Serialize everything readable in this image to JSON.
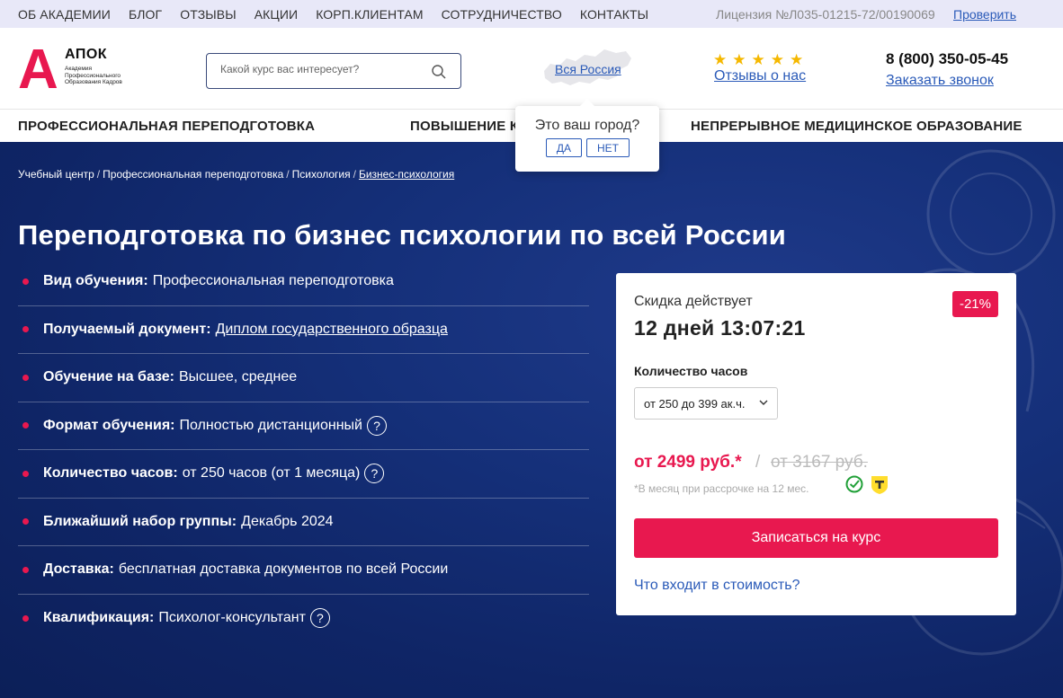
{
  "topbar": {
    "nav": [
      "ОБ АКАДЕМИИ",
      "БЛОГ",
      "ОТЗЫВЫ",
      "АКЦИИ",
      "КОРП.КЛИЕНТАМ",
      "СОТРУДНИЧЕСТВО",
      "КОНТАКТЫ"
    ],
    "license": "Лицензия №Л035-01215-72/00190069",
    "verify": "Проверить"
  },
  "header": {
    "logo_letter": "А",
    "logo_name": "АПОК",
    "logo_sub": "Академия Профессионального Образования Кадров",
    "search_placeholder": "Какой курс вас интересует?",
    "region": "Вся Россия",
    "reviews": "Отзывы о нас",
    "rating_stars": 5,
    "phone": "8 (800) 350-05-45",
    "callback": "Заказать звонок"
  },
  "catnav": {
    "items": [
      "ПРОФЕССИОНАЛЬНАЯ ПЕРЕПОДГОТОВКА",
      "ПОВЫШЕНИЕ К",
      "НЕПРЕРЫВНОЕ МЕДИЦИНСКОЕ ОБРАЗОВАНИЕ"
    ]
  },
  "popup": {
    "question": "Это ваш город?",
    "yes": "ДА",
    "no": "НЕТ"
  },
  "breadcrumb": [
    "Учебный центр",
    "Профессиональная переподготовка",
    "Психология",
    "Бизнес-психология"
  ],
  "title": "Переподготовка по бизнес психологии по всей России",
  "features": [
    {
      "label": "Вид обучения:",
      "value": "Профессиональная переподготовка"
    },
    {
      "label": "Получаемый документ:",
      "value": "Диплом государственного образца"
    },
    {
      "label": "Обучение на базе:",
      "value": "Высшее, среднее"
    },
    {
      "label": "Формат обучения:",
      "value": "Полностью дистанционный"
    },
    {
      "label": "Количество часов:",
      "value": "от 250 часов (от 1 месяца)"
    },
    {
      "label": "Ближайший набор группы:",
      "value": "Декабрь 2024"
    },
    {
      "label": "Доставка:",
      "value": "бесплатная доставка документов по всей России"
    },
    {
      "label": "Квалификация:",
      "value": "Психолог-консультант"
    }
  ],
  "card": {
    "discount_label": "Скидка действует",
    "timer": "12 дней 13:07:21",
    "badge": "-21%",
    "hours_label": "Количество часов",
    "hours_selected": "от 250 до 399 ак.ч.",
    "price": "от 2499 руб.*",
    "slash": "/",
    "old_price": "от 3167 руб.",
    "installment": "*В месяц при рассрочке на 12 мес.",
    "enroll": "Записаться на курс",
    "whats_included": "Что входит в стоимость?"
  },
  "colors": {
    "accent": "#e8184f",
    "link": "#2a5ab8",
    "hero_bg": "#15307a",
    "star": "#f5b800"
  },
  "help_glyph": "?"
}
